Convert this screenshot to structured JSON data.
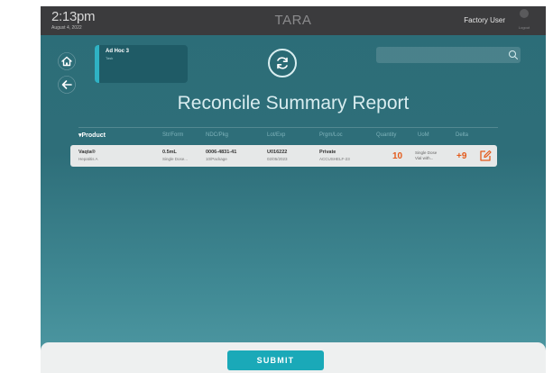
{
  "header": {
    "time": "2:13pm",
    "date": "August 4, 2022",
    "brand": "TARA",
    "user": "Factory User",
    "logout_label": "Logout"
  },
  "task": {
    "title": "Ad Hoc 3",
    "subtitle": "Task"
  },
  "search": {
    "value": "",
    "placeholder": ""
  },
  "report": {
    "title": "Reconcile Summary Report"
  },
  "table": {
    "columns": [
      "Product",
      "Str/Form",
      "NDC/Pkg",
      "Lot/Exp",
      "Prgm/Loc",
      "Quantity",
      "UoM",
      "Delta"
    ],
    "rows": [
      {
        "product": "Vaqta®",
        "product_sub": "Hepatitis A",
        "strength": "0.5mL",
        "form": "Single Dose...",
        "ndc": "0006-4831-41",
        "pkg": "10/Package",
        "lot": "U016222",
        "exp": "02/05/2023",
        "program": "Private",
        "location": "ACCUSHELF-23",
        "quantity": "10",
        "uom_line1": "Single Dose",
        "uom_line2": "Vial with...",
        "delta": "+9"
      }
    ]
  },
  "footer": {
    "submit_label": "SUBMIT"
  },
  "colors": {
    "accent": "#1aa9b8",
    "warning": "#e45a1a",
    "topbar": "#3b3b3d",
    "background": "#2e6e79"
  },
  "icons": [
    "home-icon",
    "back-arrow-icon",
    "sync-icon",
    "search-icon",
    "edit-icon",
    "logout-icon",
    "sort-down-icon"
  ]
}
